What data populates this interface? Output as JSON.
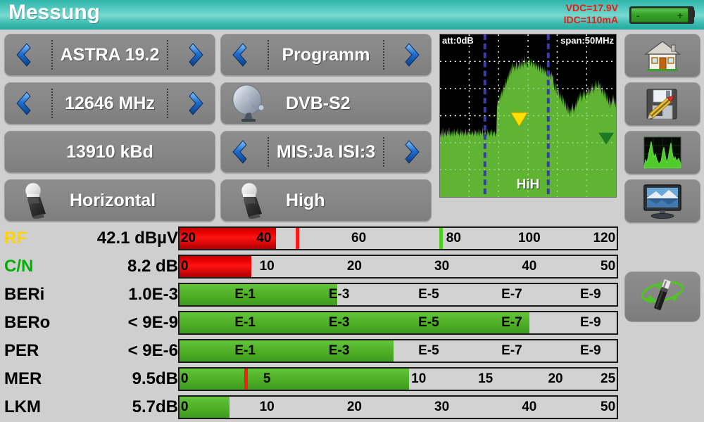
{
  "header": {
    "title": "Messung",
    "vdc": "VDC=17.9V",
    "idc": "IDC=110mA",
    "battery_minus": "-",
    "battery_plus": "+",
    "accent_color": "#35b8ae",
    "readout_color": "#f01b10"
  },
  "controls": [
    {
      "name": "satellite",
      "label": "ASTRA 19.2",
      "left_arrow": true,
      "right_arrow": true,
      "icon": null
    },
    {
      "name": "programm",
      "label": "Programm",
      "left_arrow": true,
      "right_arrow": true,
      "icon": null
    },
    {
      "name": "frequency",
      "label": "12646 MHz",
      "left_arrow": true,
      "right_arrow": true,
      "icon": null
    },
    {
      "name": "standard",
      "label": "DVB-S2",
      "left_arrow": false,
      "right_arrow": false,
      "icon": "satellite-dish-icon"
    },
    {
      "name": "symbolrate",
      "label": "13910 kBd",
      "left_arrow": false,
      "right_arrow": false,
      "icon": null
    },
    {
      "name": "mis-isi",
      "label": "MIS:Ja ISI:3",
      "left_arrow": true,
      "right_arrow": true,
      "icon": null
    },
    {
      "name": "polarity",
      "label": "Horizontal",
      "left_arrow": false,
      "right_arrow": false,
      "icon": "lnb-icon"
    },
    {
      "name": "band",
      "label": "High",
      "left_arrow": false,
      "right_arrow": false,
      "icon": "lnb-icon"
    }
  ],
  "spectrum": {
    "att_label": "att:0dB",
    "span_label": "span:50MHz",
    "band_label": "HiH",
    "background_color": "#000000",
    "trace_color": "#5fb433",
    "grid_color": "#ffffff",
    "marker_color": "#3b3bb0",
    "peak_marker_color": "#ffe000",
    "marker_positions_pct": [
      25.5,
      61.5
    ],
    "peak_marker_pct": 45,
    "trace": [
      42,
      45,
      41,
      47,
      43,
      49,
      44,
      41,
      46,
      43,
      48,
      44,
      42,
      47,
      43,
      45,
      49,
      44,
      42,
      46,
      43,
      47,
      44,
      42,
      45,
      48,
      43,
      46,
      42,
      47,
      44,
      49,
      43,
      45,
      42,
      46,
      44,
      48,
      43,
      45,
      47,
      42,
      46,
      44,
      43,
      48,
      45,
      42,
      47,
      43,
      46,
      44,
      49,
      42,
      45,
      43,
      47,
      44,
      46,
      42,
      48,
      43,
      45,
      47,
      44,
      42,
      46,
      43,
      48,
      45,
      42,
      47,
      43,
      45,
      44,
      49,
      42,
      46,
      43,
      47,
      45,
      44,
      42,
      48,
      43,
      46,
      45,
      42,
      47,
      43,
      44,
      48,
      42,
      45,
      46,
      43,
      47,
      42,
      44,
      45,
      62,
      66,
      69,
      64,
      71,
      67,
      73,
      68,
      75,
      70,
      77,
      72,
      79,
      74,
      81,
      76,
      83,
      78,
      85,
      80,
      87,
      82,
      89,
      84,
      91,
      86,
      93,
      88,
      95,
      90,
      92,
      87,
      94,
      89,
      96,
      91,
      88,
      94,
      90,
      97,
      92,
      89,
      95,
      91,
      98,
      93,
      90,
      96,
      92,
      99,
      94,
      91,
      97,
      93,
      90,
      96,
      92,
      98,
      94,
      91,
      97,
      93,
      95,
      90,
      96,
      92,
      94,
      89,
      95,
      91,
      93,
      88,
      94,
      90,
      92,
      87,
      93,
      89,
      91,
      86,
      92,
      88,
      90,
      85,
      91,
      87,
      89,
      84,
      90,
      86,
      88,
      83,
      89,
      85,
      87,
      82,
      88,
      84,
      86,
      81,
      78,
      74,
      80,
      76,
      72,
      78,
      74,
      70,
      76,
      72,
      68,
      74,
      70,
      66,
      72,
      68,
      64,
      70,
      66,
      62,
      68,
      64,
      60,
      66,
      62,
      58,
      64,
      60,
      56,
      62,
      58,
      64,
      60,
      66,
      62,
      58,
      64,
      60,
      66,
      62,
      68,
      64,
      70,
      66,
      72,
      68,
      74,
      70,
      66,
      72,
      68,
      74,
      70,
      76,
      72,
      68,
      74,
      70,
      76,
      72,
      78,
      74,
      70,
      76,
      72,
      78,
      74,
      80,
      76,
      72,
      78,
      74,
      80,
      76,
      82,
      78,
      74,
      80,
      76,
      82,
      78,
      74,
      80,
      76,
      72,
      78,
      74,
      70,
      76,
      72,
      68,
      74,
      70,
      66,
      72,
      68,
      64,
      70,
      66,
      62,
      68,
      64,
      70,
      66,
      72,
      68,
      64,
      70,
      66,
      62
    ]
  },
  "rail_buttons": [
    {
      "name": "home-button",
      "icon": "house-icon"
    },
    {
      "name": "save-button",
      "icon": "floppy-pencil-icon"
    },
    {
      "name": "spectrum-button",
      "icon": "spectrum-graph-icon"
    },
    {
      "name": "monitor-button",
      "icon": "monitor-picture-icon"
    },
    {
      "name": "align-wizard-button",
      "icon": "magic-wand-icon"
    }
  ],
  "measurements": [
    {
      "name": "RF",
      "label": "RF",
      "label_color": "#ffd400",
      "value": "42.1 dBµV",
      "bar": {
        "type": "scale",
        "fill_color": "red",
        "fill_pct": 22.0,
        "ticks": [
          {
            "text": "20",
            "pct": 0.3,
            "align": "left"
          },
          {
            "text": "40",
            "pct": 21.0,
            "align": "right"
          },
          {
            "text": "60",
            "pct": 41.0,
            "align": "center"
          },
          {
            "text": "80",
            "pct": 61.0,
            "align": "left"
          },
          {
            "text": "100",
            "pct": 80.0,
            "align": "center"
          },
          {
            "text": "120",
            "pct": 99.7,
            "align": "right"
          }
        ],
        "markers": [
          {
            "pct": 26.5,
            "color": "red-m"
          },
          {
            "pct": 59.5,
            "color": "green-m"
          }
        ]
      }
    },
    {
      "name": "CN",
      "label": "C/N",
      "label_color": "#00b000",
      "value": "8.2 dB",
      "bar": {
        "type": "scale",
        "fill_color": "red",
        "fill_pct": 16.4,
        "ticks": [
          {
            "text": "0",
            "pct": 0.3,
            "align": "left"
          },
          {
            "text": "10",
            "pct": 20.0,
            "align": "center"
          },
          {
            "text": "20",
            "pct": 40.0,
            "align": "center"
          },
          {
            "text": "30",
            "pct": 60.0,
            "align": "center"
          },
          {
            "text": "40",
            "pct": 80.0,
            "align": "center"
          },
          {
            "text": "50",
            "pct": 99.7,
            "align": "right"
          }
        ],
        "markers": []
      }
    },
    {
      "name": "BERi",
      "label": "BERi",
      "label_color": "#000000",
      "value": "1.0E-3",
      "bar": {
        "type": "scale",
        "fill_color": "green",
        "fill_pct": 36.0,
        "ticks": [
          {
            "text": "E-1",
            "pct": 15.0,
            "align": "center"
          },
          {
            "text": "E-3",
            "pct": 36.5,
            "align": "center"
          },
          {
            "text": "E-5",
            "pct": 57.0,
            "align": "center"
          },
          {
            "text": "E-7",
            "pct": 76.0,
            "align": "center"
          },
          {
            "text": "E-9",
            "pct": 94.0,
            "align": "center"
          }
        ],
        "markers": []
      }
    },
    {
      "name": "BERo",
      "label": "BERo",
      "label_color": "#000000",
      "value": "< 9E-9",
      "bar": {
        "type": "scale",
        "fill_color": "green",
        "fill_pct": 80.0,
        "ticks": [
          {
            "text": "E-1",
            "pct": 15.0,
            "align": "center"
          },
          {
            "text": "E-3",
            "pct": 36.5,
            "align": "center"
          },
          {
            "text": "E-5",
            "pct": 57.0,
            "align": "center"
          },
          {
            "text": "E-7",
            "pct": 76.0,
            "align": "center"
          },
          {
            "text": "E-9",
            "pct": 94.0,
            "align": "center"
          }
        ],
        "markers": []
      }
    },
    {
      "name": "PER",
      "label": "PER",
      "label_color": "#000000",
      "value": "< 9E-6",
      "bar": {
        "type": "scale",
        "fill_color": "green",
        "fill_pct": 49.0,
        "ticks": [
          {
            "text": "E-1",
            "pct": 15.0,
            "align": "center"
          },
          {
            "text": "E-3",
            "pct": 36.5,
            "align": "center"
          },
          {
            "text": "E-5",
            "pct": 57.0,
            "align": "center"
          },
          {
            "text": "E-7",
            "pct": 76.0,
            "align": "center"
          },
          {
            "text": "E-9",
            "pct": 94.0,
            "align": "center"
          }
        ],
        "markers": []
      }
    },
    {
      "name": "MER",
      "label": "MER",
      "label_color": "#000000",
      "value": "9.5dB",
      "bar": {
        "type": "scale",
        "fill_color": "green",
        "fill_pct": 52.5,
        "ticks": [
          {
            "text": "0",
            "pct": 0.3,
            "align": "left"
          },
          {
            "text": "5",
            "pct": 20.0,
            "align": "center"
          },
          {
            "text": "10",
            "pct": 53.0,
            "align": "left"
          },
          {
            "text": "15",
            "pct": 70.0,
            "align": "center"
          },
          {
            "text": "20",
            "pct": 86.0,
            "align": "center"
          },
          {
            "text": "25",
            "pct": 99.7,
            "align": "right"
          }
        ],
        "markers": [
          {
            "pct": 14.8,
            "color": "red-m"
          }
        ]
      }
    },
    {
      "name": "LKM",
      "label": "LKM",
      "label_color": "#000000",
      "value": "5.7dB",
      "bar": {
        "type": "scale",
        "fill_color": "green",
        "fill_pct": 11.4,
        "ticks": [
          {
            "text": "0",
            "pct": 0.3,
            "align": "left"
          },
          {
            "text": "10",
            "pct": 20.0,
            "align": "center"
          },
          {
            "text": "20",
            "pct": 40.0,
            "align": "center"
          },
          {
            "text": "30",
            "pct": 60.0,
            "align": "center"
          },
          {
            "text": "40",
            "pct": 80.0,
            "align": "center"
          },
          {
            "text": "50",
            "pct": 99.7,
            "align": "right"
          }
        ],
        "markers": []
      }
    }
  ]
}
